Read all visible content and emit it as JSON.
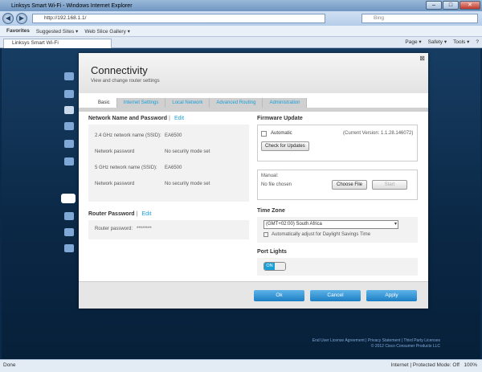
{
  "window": {
    "title": "Linksys Smart Wi-Fi - Windows Internet Explorer"
  },
  "address": {
    "url": "http://192.168.1.1/",
    "search_placeholder": "Bing"
  },
  "favorites": {
    "label": "Favorites",
    "items": [
      "Suggested Sites ▾",
      "Web Slice Gallery ▾"
    ]
  },
  "tab": {
    "label": "Linksys Smart Wi-Fi"
  },
  "commands": [
    "Page ▾",
    "Safety ▾",
    "Tools ▾",
    "?"
  ],
  "panel": {
    "title": "Connectivity",
    "subtitle": "View and change router settings",
    "tabs": [
      "Basic",
      "Internet Settings",
      "Local Network",
      "Advanced Routing",
      "Administration"
    ],
    "network": {
      "heading": "Network Name and Password",
      "edit": "Edit",
      "rows": [
        {
          "k": "2.4 GHz network name (SSID):",
          "v": "EA6500"
        },
        {
          "k": "Network password",
          "v": "No security mode set"
        },
        {
          "k": "5 GHz network name (SSID):",
          "v": "EA6500"
        },
        {
          "k": "Network password",
          "v": "No security mode set"
        }
      ]
    },
    "router_pw": {
      "heading": "Router Password",
      "edit": "Edit",
      "label": "Router password:",
      "value": "********"
    },
    "firmware": {
      "heading": "Firmware Update",
      "auto_label": "Automatic",
      "version": "(Current Version: 1.1.28.146072)",
      "check_btn": "Check for Updates",
      "manual_label": "Manual:",
      "file_text": "No file chosen",
      "choose_btn": "Choose File",
      "start_btn": "Start"
    },
    "timezone": {
      "heading": "Time Zone",
      "selected": "(GMT+02:00) South Africa",
      "dst_label": "Automatically adjust for Daylight Savings Time"
    },
    "lights": {
      "heading": "Port Lights",
      "on": "ON"
    },
    "buttons": {
      "ok": "Ok",
      "cancel": "Cancel",
      "apply": "Apply"
    }
  },
  "legal": {
    "links": "End User License Agreement  |  Privacy Statement  |  Third Party Licenses",
    "copyright": "© 2012 Cisco Consumer Products LLC"
  },
  "status": {
    "left": "Done",
    "right": "Internet | Protected Mode: Off",
    "zoom": "100%"
  }
}
